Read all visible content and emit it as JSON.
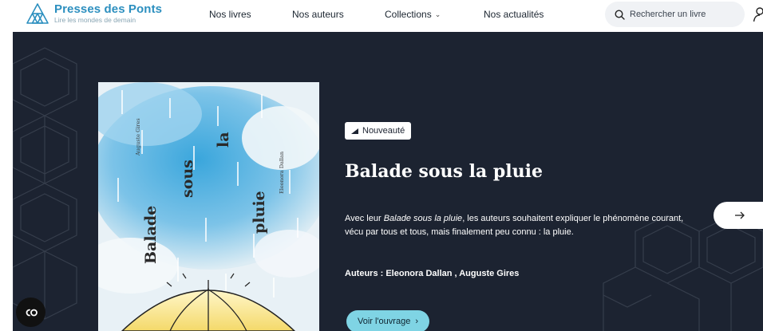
{
  "header": {
    "logo_title": "Presses des Ponts",
    "logo_tagline": "Lire les mondes de demain",
    "nav": [
      {
        "label": "Nos livres"
      },
      {
        "label": "Nos auteurs"
      },
      {
        "label": "Collections",
        "has_dropdown": true
      },
      {
        "label": "Nos actualités"
      }
    ],
    "search_placeholder": "Rechercher un livre"
  },
  "hero": {
    "badge": "Nouveauté",
    "title": "Balade sous la pluie",
    "description_prefix": "Avec leur ",
    "description_italic": "Balade sous la pluie",
    "description_suffix": ", les auteurs souhaitent expliquer le phénomène courant, vécu par tous et tous, mais finalement peu connu : la pluie.",
    "authors": "Auteurs : Eleonora Dallan , Auguste Gires",
    "cta_label": "Voir l'ouvrage",
    "cover": {
      "title_words": [
        "Balade",
        "sous",
        "la",
        "pluie"
      ],
      "author_1": "Auguste Gires",
      "author_2": "Eleonora Dallan"
    }
  },
  "colors": {
    "brand_blue": "#2c8fbf",
    "hero_bg": "#1c2331",
    "cta_bg": "#7fd4e4"
  },
  "icons": {
    "logo": "triangle-logo-icon",
    "search": "search-icon",
    "user": "user-icon",
    "next": "arrow-right-icon",
    "fab": "accessibility-icon"
  }
}
